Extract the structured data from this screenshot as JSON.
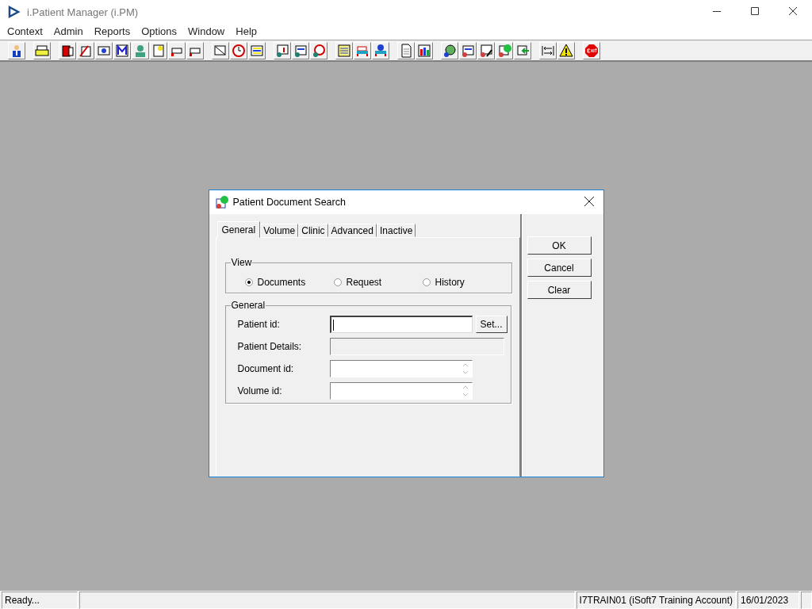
{
  "window": {
    "title": "i.Patient Manager (i.PM)"
  },
  "menu": [
    "Context",
    "Admin",
    "Reports",
    "Options",
    "Window",
    "Help"
  ],
  "dialog": {
    "title": "Patient Document Search",
    "tabs": [
      {
        "label": "General",
        "selected": true
      },
      {
        "label": "Volume",
        "selected": false
      },
      {
        "label": "Clinic",
        "selected": false
      },
      {
        "label": "Advanced",
        "selected": false
      },
      {
        "label": "Inactive",
        "selected": false
      }
    ],
    "view_group": {
      "title": "View",
      "options": [
        {
          "label": "Documents",
          "selected": true
        },
        {
          "label": "Request",
          "selected": false
        },
        {
          "label": "History",
          "selected": false
        }
      ]
    },
    "general_group": {
      "title": "General",
      "fields": [
        {
          "label": "Patient id:",
          "kind": "text",
          "focused": true,
          "button": "Set..."
        },
        {
          "label": "Patient Details:",
          "kind": "disabled",
          "focused": false
        },
        {
          "label": "Document id:",
          "kind": "spinner",
          "focused": false
        },
        {
          "label": "Volume id:",
          "kind": "spinner",
          "focused": false
        }
      ]
    },
    "buttons": [
      "OK",
      "Cancel",
      "Clear"
    ]
  },
  "status_bar": {
    "message": "Ready...",
    "account": "I7TRAIN01 (iSoft7 Training Account)",
    "date": "16/01/2023"
  }
}
